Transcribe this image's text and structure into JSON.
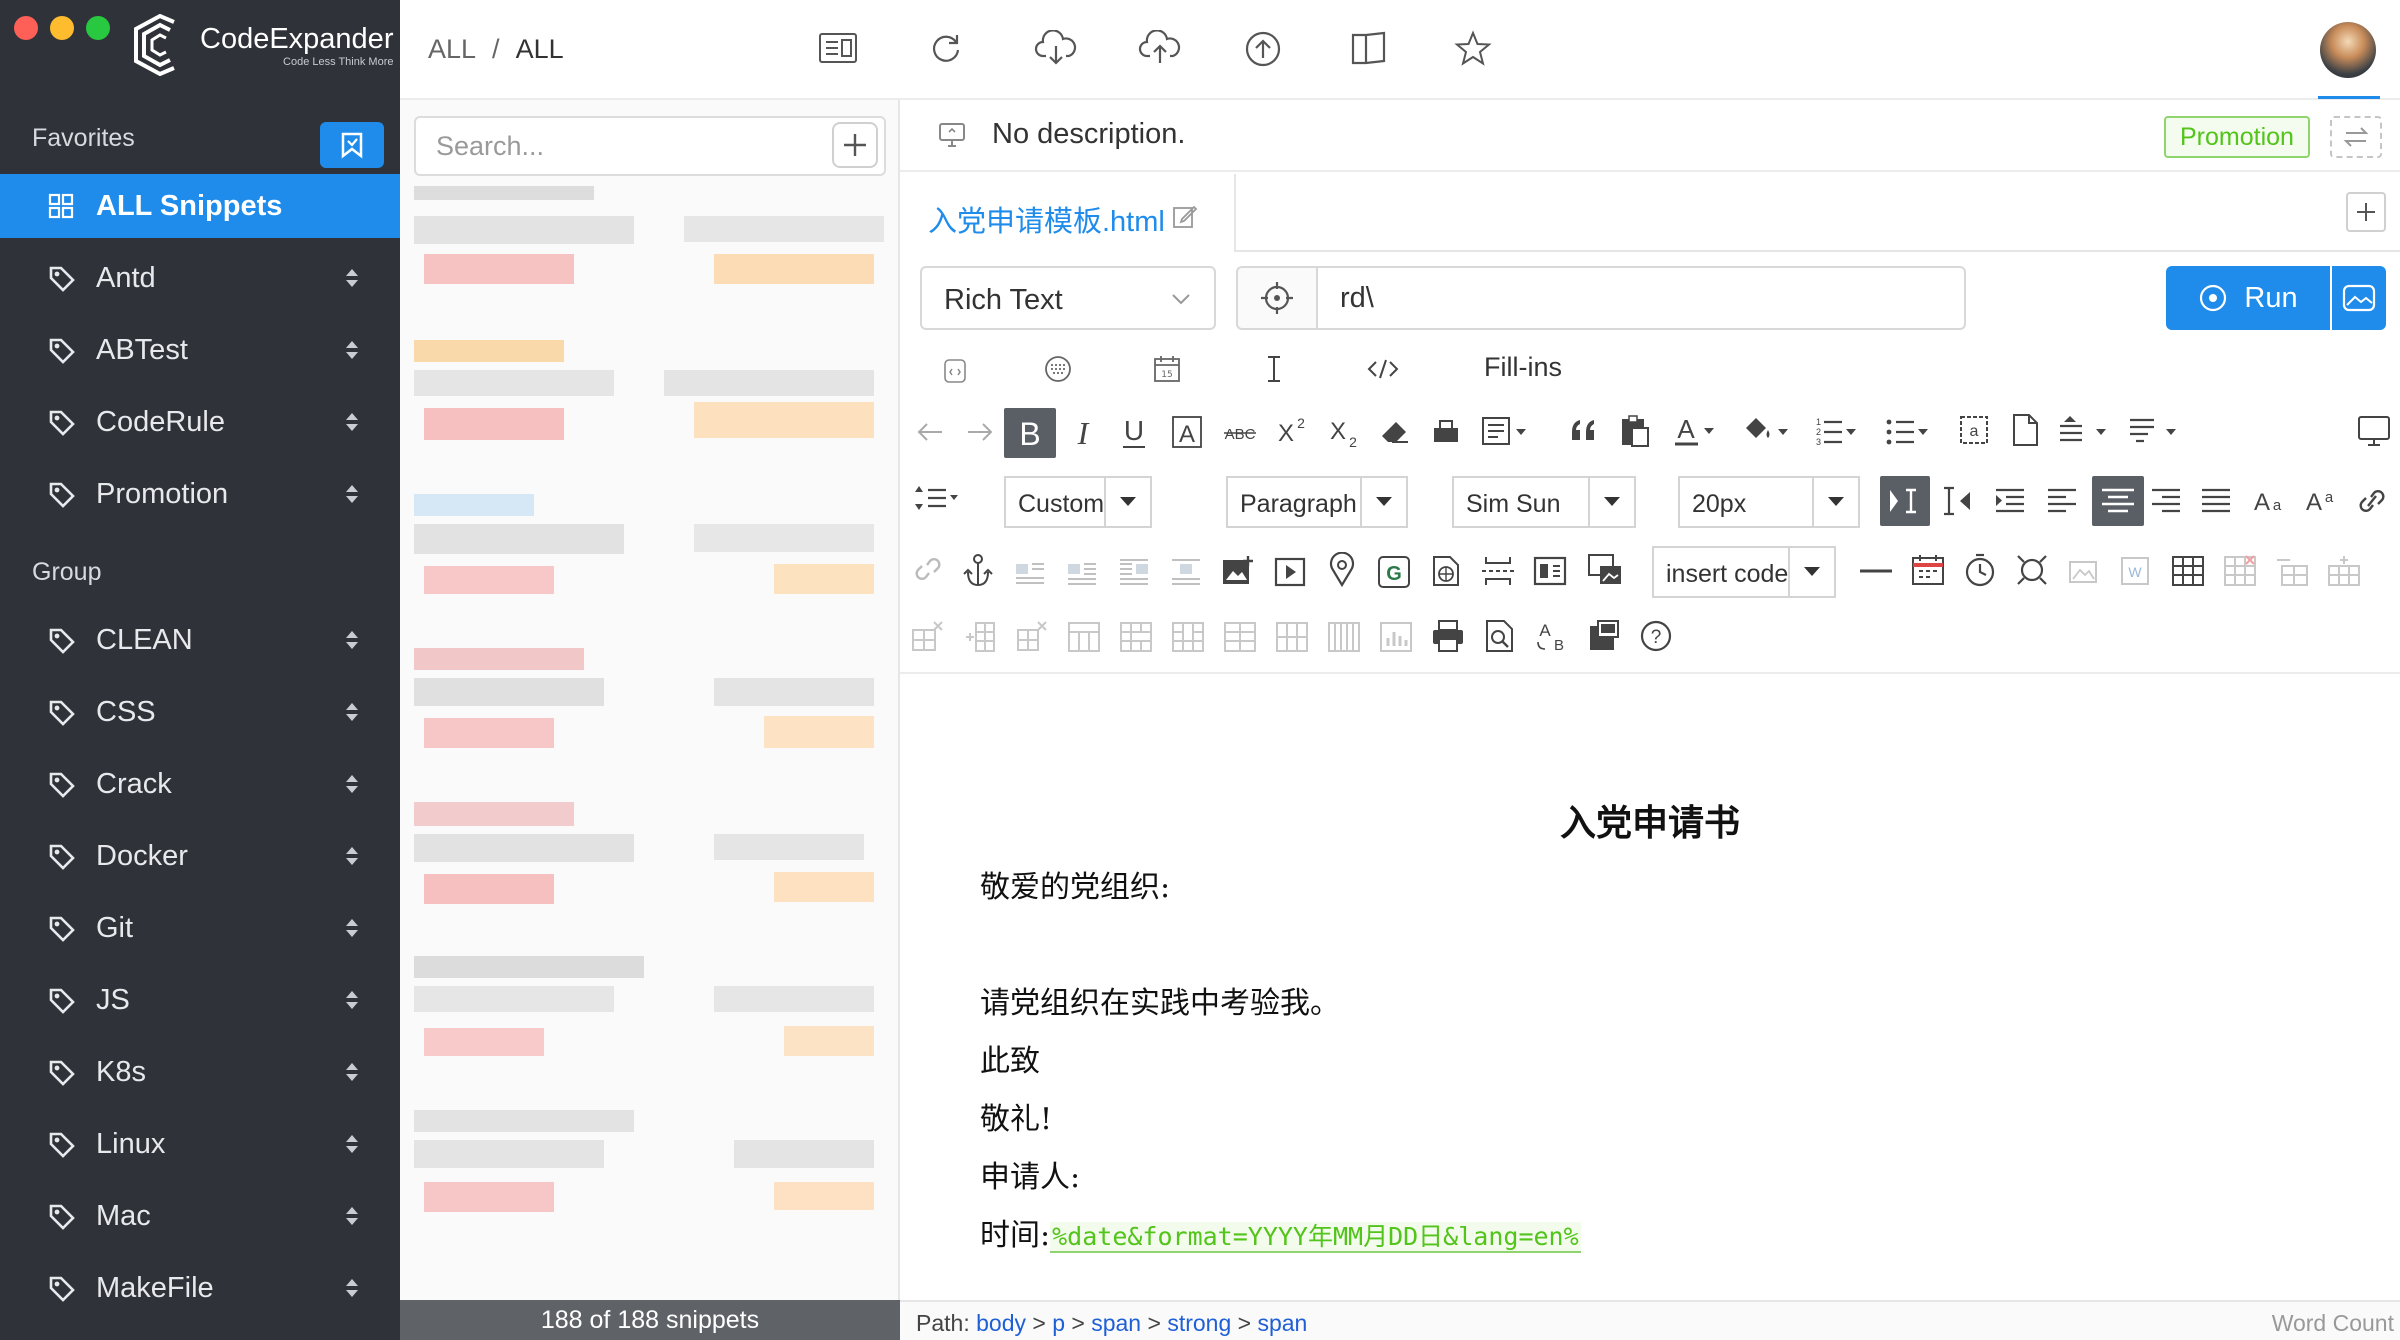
{
  "app": {
    "name": "CodeExpander",
    "tagline": "Code Less Think More"
  },
  "sidebar": {
    "favorites_title": "Favorites",
    "favorites": [
      {
        "label": "ALL Snippets",
        "icon": "grid-icon",
        "active": true
      },
      {
        "label": "Antd",
        "icon": "tag-icon"
      },
      {
        "label": "ABTest",
        "icon": "tag-icon"
      },
      {
        "label": "CodeRule",
        "icon": "tag-icon"
      },
      {
        "label": "Promotion",
        "icon": "tag-icon"
      }
    ],
    "group_title": "Group",
    "groups": [
      {
        "label": "CLEAN"
      },
      {
        "label": "CSS"
      },
      {
        "label": "Crack"
      },
      {
        "label": "Docker"
      },
      {
        "label": "Git"
      },
      {
        "label": "JS"
      },
      {
        "label": "K8s"
      },
      {
        "label": "Linux"
      },
      {
        "label": "Mac"
      },
      {
        "label": "MakeFile"
      }
    ]
  },
  "header": {
    "breadcrumb_root": "ALL",
    "breadcrumb_sep": "/",
    "breadcrumb_current": "ALL",
    "toolbar_icons": [
      "list-detail-icon",
      "sync-icon",
      "cloud-download-icon",
      "cloud-upload-icon",
      "upload-arrow-icon",
      "book-icon",
      "star-icon"
    ]
  },
  "list": {
    "search_placeholder": "Search...",
    "footer": "188 of 188 snippets"
  },
  "editor": {
    "description": "No description.",
    "promotion_tag": "Promotion",
    "file_tab": "入党申请模板.html",
    "type_select": "Rich Text",
    "abbreviation": "rd\\",
    "run_label": "Run",
    "fillins_label": "Fill-ins",
    "toolbar": {
      "custom_style": "CustomSt",
      "paragraph": "Paragraph",
      "font": "Sim Sun",
      "size": "20px",
      "insert_code": "insert code"
    },
    "document": {
      "title": "入党申请书",
      "salutation": "敬爱的党组织:",
      "line1": "请党组织在实践中考验我。",
      "line2": "此致",
      "line3": "敬礼!",
      "line4": "申请人:",
      "time_label": "时间:",
      "time_fill": "%date&format=YYYY年MM月DD日&lang=en%"
    },
    "status": {
      "path_label": "Path:",
      "path": [
        "body",
        "p",
        "span",
        "strong",
        "span"
      ],
      "separator": ">",
      "word_count": "Word Count"
    }
  },
  "colors": {
    "sidebar_bg": "#2f3238",
    "accent": "#1f8ceb",
    "fill_in_green": "#52c41a"
  }
}
